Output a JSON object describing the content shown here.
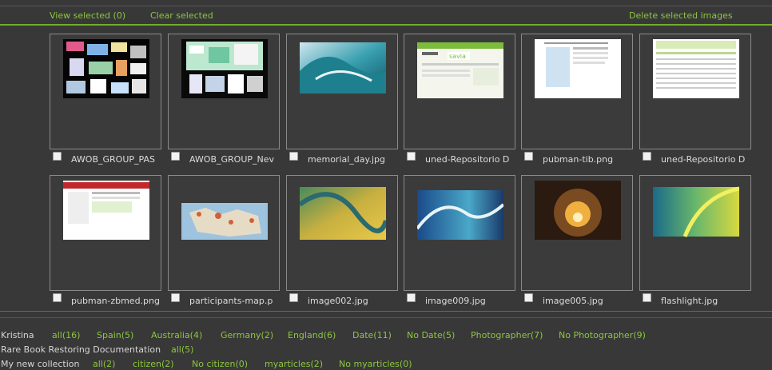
{
  "toolbar": {
    "view_selected": "View selected (0)",
    "clear_selected": "Clear selected",
    "delete_selected": "Delete selected images"
  },
  "images": [
    {
      "name": "AWOB_GROUP_PAS"
    },
    {
      "name": "AWOB_GROUP_Nev"
    },
    {
      "name": "memorial_day.jpg"
    },
    {
      "name": "uned-Repositorio D"
    },
    {
      "name": "pubman-tib.png"
    },
    {
      "name": "uned-Repositorio D"
    },
    {
      "name": "pubman-zbmed.png"
    },
    {
      "name": "participants-map.p"
    },
    {
      "name": "image002.jpg"
    },
    {
      "name": "image009.jpg"
    },
    {
      "name": "image005.jpg"
    },
    {
      "name": "flashlight.jpg"
    }
  ],
  "collections": [
    {
      "name": "Kristina",
      "filters": [
        "all(16)",
        "Spain(5)",
        "Australia(4)",
        "Germany(2)",
        "England(6)",
        "Date(11)",
        "No Date(5)",
        "Photographer(7)",
        "No Photographer(9)"
      ]
    },
    {
      "name": "Rare Book Restoring Documentation",
      "filters": [
        "all(5)"
      ]
    },
    {
      "name": "My new collection",
      "filters": [
        "all(2)",
        "citizen(2)",
        "No citizen(0)",
        "myarticles(2)",
        "No myarticles(0)"
      ]
    }
  ],
  "colors": {
    "accent": "#8cc63f",
    "background": "#383838",
    "border": "#8a8a8a"
  }
}
